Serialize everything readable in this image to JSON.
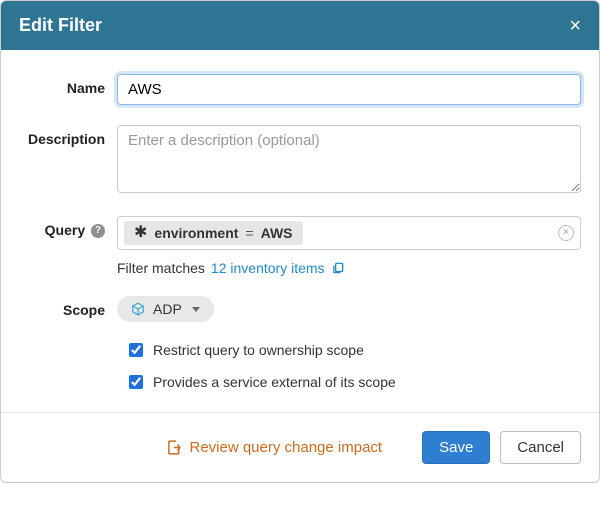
{
  "header": {
    "title": "Edit Filter",
    "close_glyph": "×"
  },
  "labels": {
    "name": "Name",
    "description": "Description",
    "query": "Query",
    "scope": "Scope"
  },
  "form": {
    "name_value": "AWS",
    "description_value": "",
    "description_placeholder": "Enter a description (optional)"
  },
  "query": {
    "chip": {
      "asterisk": "✱",
      "key": "environment",
      "op": "=",
      "value": "AWS"
    },
    "clear_glyph": "×",
    "matches_prefix": "Filter matches ",
    "matches_link": "12 inventory items"
  },
  "scope": {
    "label": "ADP"
  },
  "checks": {
    "restrict": {
      "checked": true,
      "label": "Restrict query to ownership scope"
    },
    "provides": {
      "checked": true,
      "label": "Provides a service external of its scope"
    }
  },
  "footer": {
    "review": "Review query change impact",
    "save": "Save",
    "cancel": "Cancel"
  }
}
